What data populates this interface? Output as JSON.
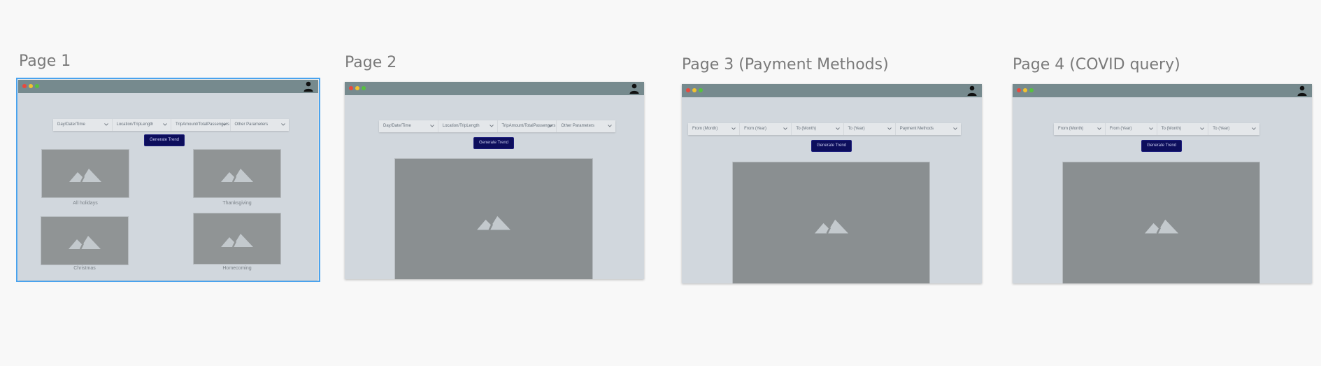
{
  "pages": [
    {
      "title": "Page 1",
      "filters": [
        "Day/Date/Time",
        "Location/TripLength",
        "TripAmount/TotalPassengers",
        "Other Parameters"
      ],
      "button": "Generate Trend",
      "captions": [
        "All holidays",
        "Thanksgiving",
        "Christmas",
        "Homecoming"
      ]
    },
    {
      "title": "Page 2",
      "filters": [
        "Day/Date/Time",
        "Location/TripLength",
        "TripAmount/TotalPassengers",
        "Other Parameters"
      ],
      "button": "Generate Trend"
    },
    {
      "title": "Page 3 (Payment Methods)",
      "filters": [
        "From (Month)",
        "From (Year)",
        "To (Month)",
        "To (Year)",
        "Payment Methods"
      ],
      "button": "Generate Trend"
    },
    {
      "title": "Page 4 (COVID query)",
      "filters": [
        "From (Month)",
        "From (Year)",
        "To (Month)",
        "To (Year)"
      ],
      "button": "Generate Trend"
    }
  ],
  "icons": {
    "user": "user-icon",
    "chevron": "chevron-down-icon",
    "image": "image-placeholder-icon"
  },
  "colors": {
    "canvas": "#f8f8f8",
    "frame_bg": "#d1d7dd",
    "titlebar": "#768a8e",
    "button": "#0d0e5c",
    "selection": "#4aa3ee",
    "image_placeholder": "#8a8f91"
  }
}
